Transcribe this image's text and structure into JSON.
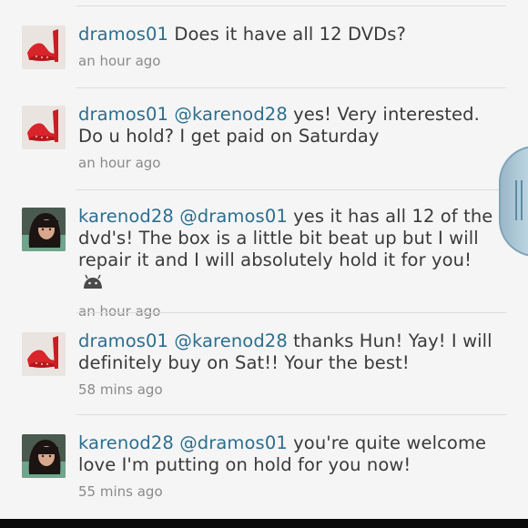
{
  "comments": [
    {
      "user": "dramos01",
      "mention": "",
      "text": "Does it have all 12 DVDs?",
      "time": "an hour ago",
      "avatar": "red-shoe-avatar"
    },
    {
      "user": "dramos01",
      "mention": "@karenod28",
      "text": "yes! Very interested. Do u hold? I get paid on Saturday",
      "time": "an hour ago",
      "avatar": "red-shoe-avatar"
    },
    {
      "user": "karenod28",
      "mention": "@dramos01",
      "text": "yes it has all 12 of the dvd's! The box is a little bit beat up but I will repair it and I will absolutely hold it for you!",
      "time": "an hour ago",
      "avatar": "woman-photo-avatar",
      "emoji": "android-emoji-icon"
    },
    {
      "user": "dramos01",
      "mention": "@karenod28",
      "text": "thanks Hun! Yay! I will definitely buy on Sat!! Your the best!",
      "time": "58 mins ago",
      "avatar": "red-shoe-avatar"
    },
    {
      "user": "karenod28",
      "mention": "@dramos01",
      "text": "you're quite welcome love I'm putting on hold for you now!",
      "time": "55 mins ago",
      "avatar": "woman-photo-avatar"
    }
  ],
  "colors": {
    "username": "#2c6e8f",
    "text": "#3a3a3a",
    "timestamp": "#8a8a8a",
    "background": "#f5f5f5"
  }
}
